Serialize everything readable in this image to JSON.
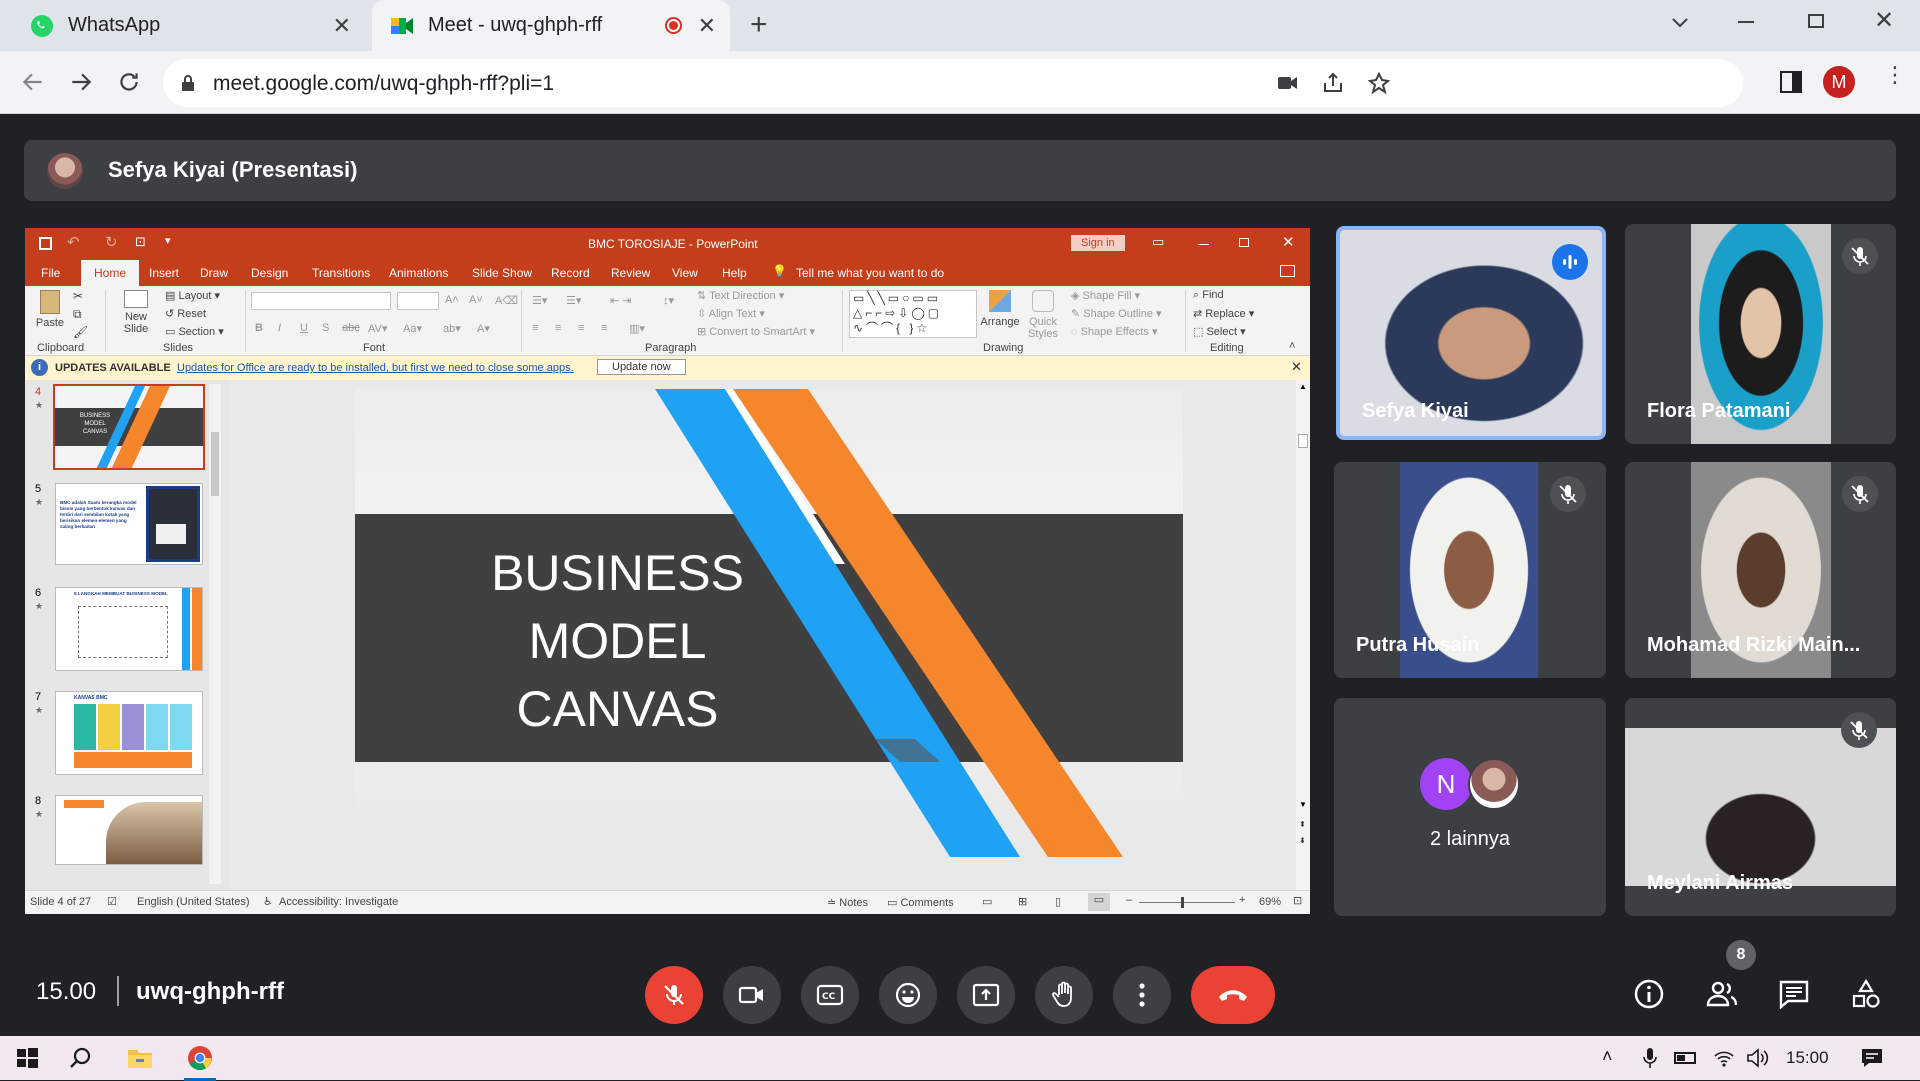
{
  "browser": {
    "tabs": [
      {
        "title": "WhatsApp"
      },
      {
        "title": "Meet - uwq-ghph-rff"
      }
    ],
    "url": "meet.google.com/uwq-ghph-rff?pli=1",
    "profile_initial": "M"
  },
  "meet": {
    "presenter_bar": "Sefya Kiyai (Presentasi)",
    "time": "15.00",
    "meeting_code": "uwq-ghph-rff",
    "participants_count": "8",
    "participants": [
      {
        "name": "Sefya Kiyai",
        "speaking": true
      },
      {
        "name": "Flora Patamani",
        "muted": true
      },
      {
        "name": "Putra Husain",
        "muted": true
      },
      {
        "name": "Mohamad Rizki Main...",
        "muted": true
      },
      {
        "name": "2 lainnya",
        "avatar_initial": "N"
      },
      {
        "name": "Meylani Airmas",
        "muted": true
      }
    ],
    "colors": {
      "end_call": "#ea4335",
      "mic_off": "#ea4335",
      "active_border": "#8ab4f8",
      "control_bg": "#3c4043"
    }
  },
  "powerpoint": {
    "window_title": "BMC TOROSIAJE - PowerPoint",
    "sign_in": "Sign in",
    "menu": [
      "File",
      "Home",
      "Insert",
      "Draw",
      "Design",
      "Transitions",
      "Animations",
      "Slide Show",
      "Record",
      "Review",
      "View",
      "Help"
    ],
    "tell_me": "Tell me what you want to do",
    "ribbon": {
      "clipboard": {
        "paste": "Paste",
        "group": "Clipboard"
      },
      "slides": {
        "new_slide": "New Slide",
        "layout": "Layout",
        "reset": "Reset",
        "section": "Section",
        "group": "Slides"
      },
      "font": {
        "group": "Font"
      },
      "paragraph": {
        "text_direction": "Text Direction",
        "align_text": "Align Text",
        "convert": "Convert to SmartArt",
        "group": "Paragraph"
      },
      "drawing": {
        "arrange": "Arrange",
        "quick_styles": "Quick Styles",
        "shape_fill": "Shape Fill",
        "shape_outline": "Shape Outline",
        "shape_effects": "Shape Effects",
        "group": "Drawing"
      },
      "editing": {
        "find": "Find",
        "replace": "Replace",
        "select": "Select",
        "group": "Editing"
      }
    },
    "update_bar": {
      "title": "UPDATES AVAILABLE",
      "message": "Updates for Office are ready to be installed, but first we need to close some apps.",
      "button": "Update now"
    },
    "thumbnails": [
      {
        "num": "4",
        "text": "BUSINESS MODEL CANVAS"
      },
      {
        "num": "5",
        "text": "BMC adalah Suatu kerangka model bisnis yang berbentuk kanvas dan terdiri dari sembilan kotak yang berisikan elemen-elemen yang saling berkaitan"
      },
      {
        "num": "6",
        "text": "9 LANGKAH MEMBUAT BUSINESS MODEL"
      },
      {
        "num": "7",
        "text": "KANVAS BMC"
      },
      {
        "num": "8",
        "text": ""
      }
    ],
    "slide_title_lines": [
      "BUSINESS",
      "MODEL",
      "CANVAS"
    ],
    "status": {
      "slide_of": "Slide 4 of 27",
      "language": "English (United States)",
      "accessibility": "Accessibility: Investigate",
      "notes": "Notes",
      "comments": "Comments",
      "zoom": "69%"
    },
    "colors": {
      "ribbon_red": "#c43e1c",
      "slide_band": "#404040",
      "stripe_blue": "#1fa2f4",
      "stripe_orange": "#f5862b"
    }
  },
  "taskbar": {
    "clock": "15:00"
  }
}
